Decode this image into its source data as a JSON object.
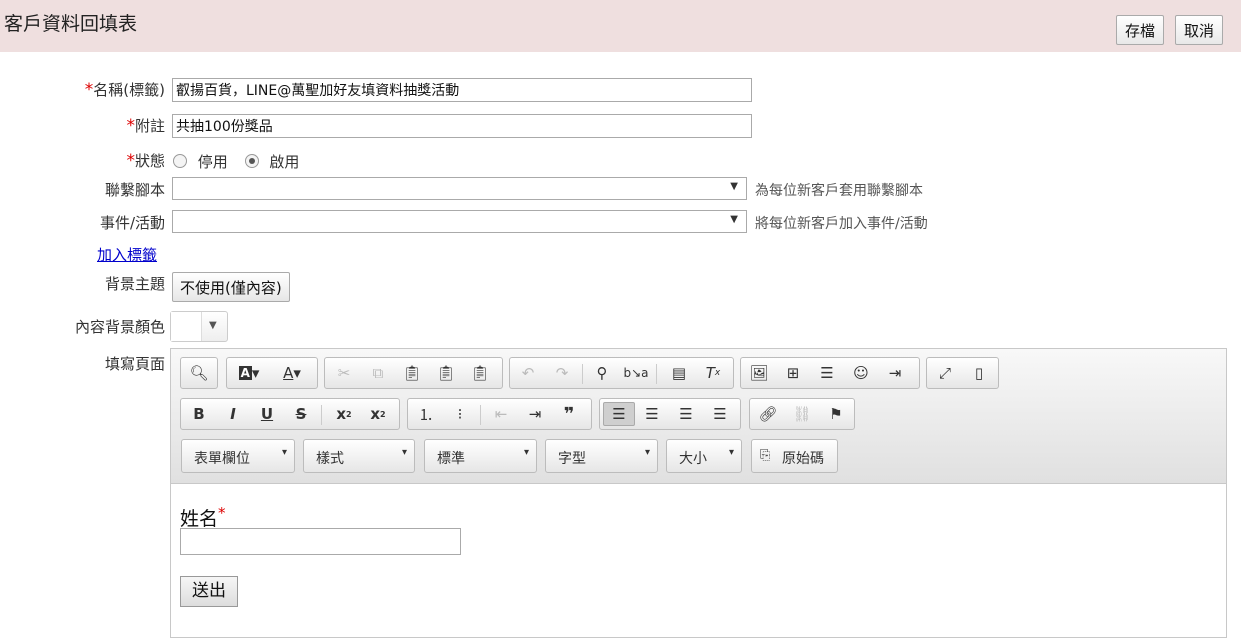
{
  "header": {
    "title": "客戶資料回填表",
    "save_label": "存檔",
    "cancel_label": "取消"
  },
  "form": {
    "required_mark": "*",
    "name_label": "名稱(標籤)",
    "name_value": "叡揚百貨，LINE@萬聖加好友填資料抽獎活動",
    "note_label": "附註",
    "note_value": "共抽100份獎品",
    "status_label": "狀態",
    "status_off": "停用",
    "status_on": "啟用",
    "script_label": "聯繫腳本",
    "script_hint": "為每位新客戶套用聯繫腳本",
    "event_label": "事件/活動",
    "event_hint": "將每位新客戶加入事件/活動",
    "add_tag_link": "加入標籤",
    "theme_label": "背景主題",
    "theme_button": "不使用(僅內容)",
    "bgcolor_label": "內容背景顏色",
    "page_label": "填寫頁面"
  },
  "editor": {
    "combos": [
      "表單欄位",
      "樣式",
      "標準",
      "字型",
      "大小"
    ],
    "source_label": "原始碼",
    "content": {
      "field_label": "姓名",
      "submit_label": "送出"
    }
  }
}
